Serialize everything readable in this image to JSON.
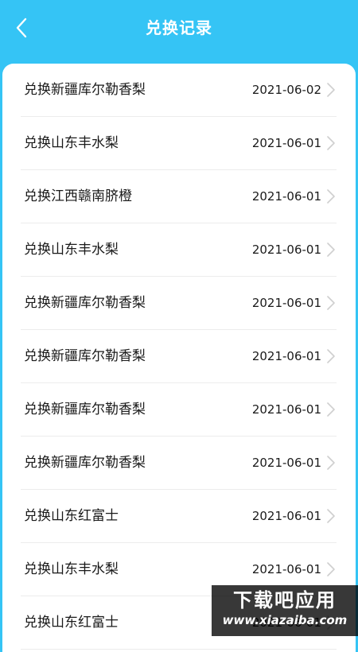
{
  "header": {
    "title": "兑换记录"
  },
  "records": [
    {
      "name": "兑换新疆库尔勒香梨",
      "date": "2021-06-02"
    },
    {
      "name": "兑换山东丰水梨",
      "date": "2021-06-01"
    },
    {
      "name": "兑换江西赣南脐橙",
      "date": "2021-06-01"
    },
    {
      "name": "兑换山东丰水梨",
      "date": "2021-06-01"
    },
    {
      "name": "兑换新疆库尔勒香梨",
      "date": "2021-06-01"
    },
    {
      "name": "兑换新疆库尔勒香梨",
      "date": "2021-06-01"
    },
    {
      "name": "兑换新疆库尔勒香梨",
      "date": "2021-06-01"
    },
    {
      "name": "兑换新疆库尔勒香梨",
      "date": "2021-06-01"
    },
    {
      "name": "兑换山东红富士",
      "date": "2021-06-01"
    },
    {
      "name": "兑换山东丰水梨",
      "date": "2021-06-01"
    },
    {
      "name": "兑换山东红富士",
      "date": "2021-06-01"
    }
  ],
  "watermark": {
    "line1": "下载吧应用",
    "line2": "www.xiazaiba.com"
  },
  "icons": {
    "back": "chevron-left-icon",
    "row_arrow": "chevron-right-icon"
  },
  "colors": {
    "header_bg": "#35c4f5",
    "card_bg": "#ffffff",
    "text": "#1a1a1a",
    "divider": "#ececec",
    "chevron": "#cfcfcf"
  }
}
